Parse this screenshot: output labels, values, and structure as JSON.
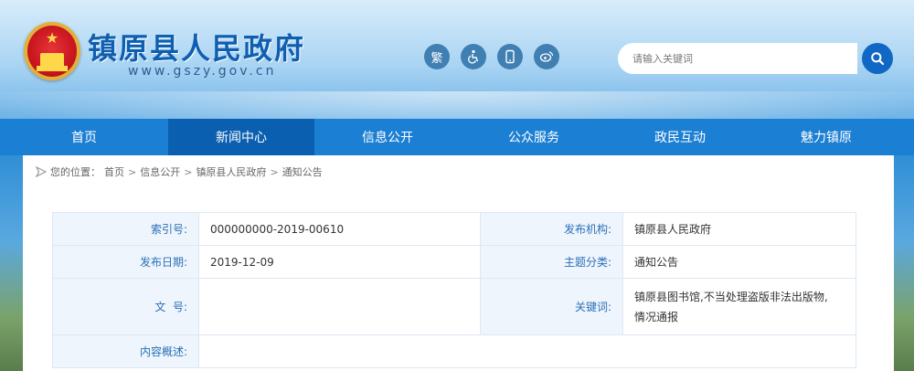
{
  "header": {
    "title": "镇原县人民政府",
    "domain": "www.gszy.gov.cn",
    "tools": [
      {
        "icon": "traditional-chinese-icon",
        "label": "繁"
      },
      {
        "icon": "accessibility-icon",
        "label": "♿"
      },
      {
        "icon": "mobile-icon",
        "label": "▯"
      },
      {
        "icon": "weibo-icon",
        "label": "☁"
      }
    ],
    "search": {
      "placeholder": "请输入关键词"
    }
  },
  "nav": {
    "items": [
      {
        "label": "首页",
        "active": false
      },
      {
        "label": "新闻中心",
        "active": true
      },
      {
        "label": "信息公开",
        "active": false
      },
      {
        "label": "公众服务",
        "active": false
      },
      {
        "label": "政民互动",
        "active": false
      },
      {
        "label": "魅力镇原",
        "active": false
      }
    ]
  },
  "breadcrumb": {
    "prefix": "您的位置：",
    "items": [
      "首页",
      "信息公开",
      "镇原县人民政府",
      "通知公告"
    ],
    "separator": ">"
  },
  "info": {
    "index_label": "索引号:",
    "index_value": "000000000-2019-00610",
    "publisher_label": "发布机构:",
    "publisher_value": "镇原县人民政府",
    "date_label": "发布日期:",
    "date_value": "2019-12-09",
    "category_label": "主题分类:",
    "category_value": "通知公告",
    "docno_label": "文  号:",
    "docno_value": "",
    "keyword_label": "关键词:",
    "keyword_value_line1": "镇原县图书馆,不当处理盗版非法出版物,",
    "keyword_value_line2": "情况通报",
    "summary_label": "内容概述:",
    "summary_value": ""
  },
  "colors": {
    "nav": "#1b7fd3",
    "nav_active": "#0b5fb0",
    "title": "#0f5fb0",
    "label_bg": "#eef5fc",
    "label_text": "#2a6fb8"
  }
}
